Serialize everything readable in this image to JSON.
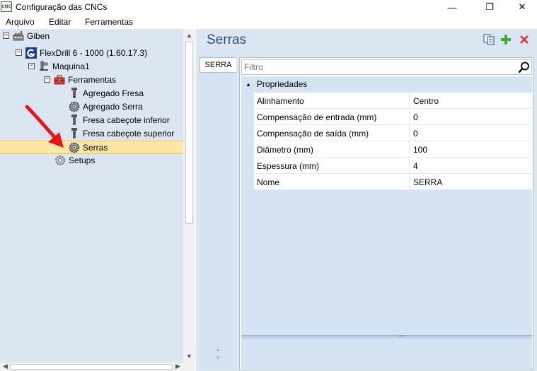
{
  "window": {
    "title": "Configuração das CNCs",
    "app_icon_text": "CNC",
    "minimize_glyph": "—",
    "maximize_glyph": "❐",
    "close_glyph": "✕"
  },
  "menu": {
    "items": [
      "Arquivo",
      "Editar",
      "Ferramentas"
    ]
  },
  "tree": {
    "collapse_glyph": "−",
    "nodes": [
      {
        "label": "Giben",
        "icon": "factory-icon",
        "expanded": true
      },
      {
        "label": "FlexDrill 6 - 1000 (1.60.17.3)",
        "icon": "giben-logo-icon",
        "expanded": true
      },
      {
        "label": "Maquina1",
        "icon": "machine-icon",
        "expanded": true
      },
      {
        "label": "Ferramentas",
        "icon": "toolbox-icon",
        "expanded": true
      },
      {
        "label": "Agregado Fresa",
        "icon": "drill-bit-icon"
      },
      {
        "label": "Agregado Serra",
        "icon": "saw-blade-icon"
      },
      {
        "label": "Fresa cabeçote inferior",
        "icon": "drill-bit-icon"
      },
      {
        "label": "Fresa cabeçote superior",
        "icon": "drill-bit-icon"
      },
      {
        "label": "Serras",
        "icon": "saw-blade-icon",
        "selected": true
      },
      {
        "label": "Setups",
        "icon": "gear-icon"
      }
    ]
  },
  "right_panel": {
    "title": "Serras",
    "tab_label": "SERRA",
    "filter_placeholder": "Filtro",
    "category": "Propriedades",
    "properties": [
      {
        "name": "Alinhamento",
        "value": "Centro"
      },
      {
        "name": "Compensação de entrada (mm)",
        "value": "0"
      },
      {
        "name": "Compensação de saída (mm)",
        "value": "0"
      },
      {
        "name": "Diâmetro (mm)",
        "value": "100"
      },
      {
        "name": "Espessura (mm)",
        "value": "4"
      },
      {
        "name": "Nome",
        "value": "SERRA"
      }
    ]
  },
  "colors": {
    "selection_bg": "#fde7a6",
    "pane_bg": "#dce6f2",
    "title_blue": "#2d4e7a",
    "add_green": "#3cae3c",
    "delete_red": "#e03030",
    "annotation_arrow": "#e8141c"
  }
}
